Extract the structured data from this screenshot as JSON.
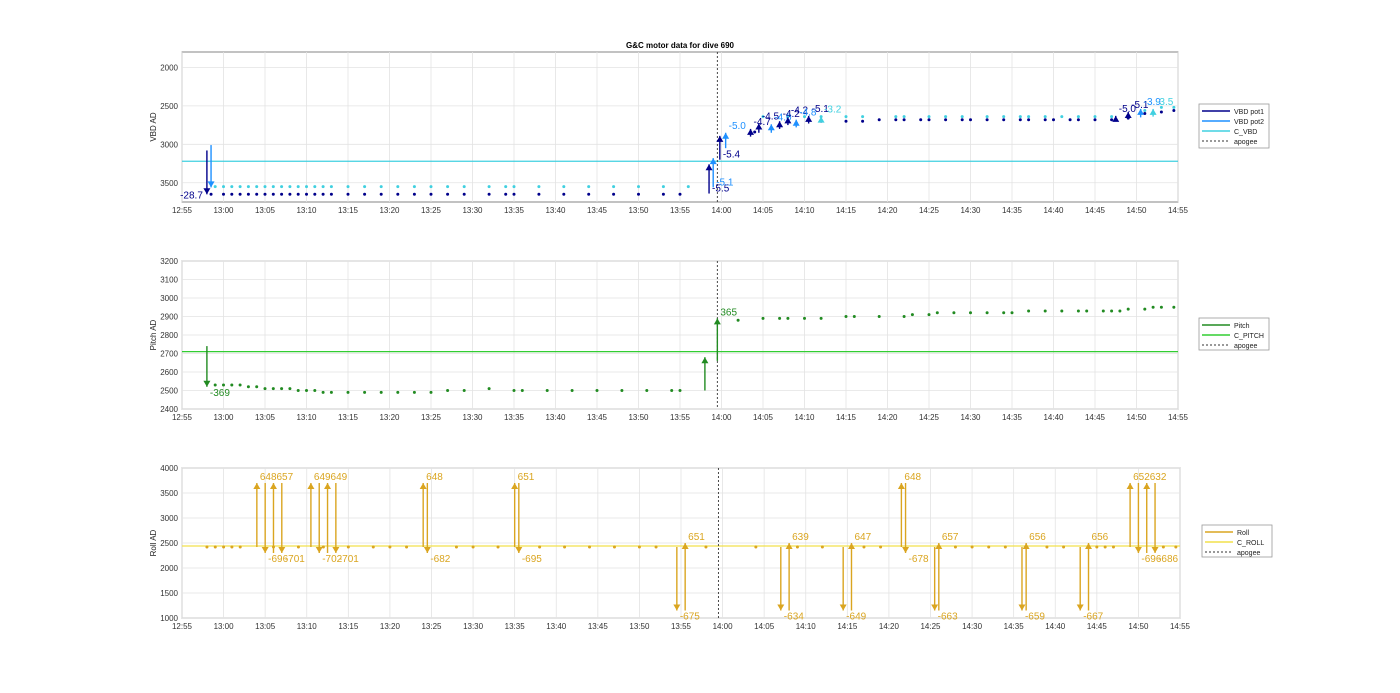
{
  "figure_title": "G&C motor data for dive 690",
  "colors": {
    "vbd_pot1": "#00008B",
    "vbd_pot2": "#1E90FF",
    "c_vbd": "#40D0E0",
    "pitch": "#228B22",
    "c_pitch": "#32CD32",
    "roll": "#DAA520",
    "c_roll": "#F2E14C",
    "apogee": "#333333"
  },
  "chart_data": [
    {
      "type": "scatter",
      "ylabel": "VBD AD",
      "ylim": [
        3750,
        1800
      ],
      "yticks": [
        2000,
        2500,
        3000,
        3500
      ],
      "reverse_y": true,
      "xlim": [
        "12:55",
        "14:55"
      ],
      "xticks": [
        "12:55",
        "13:00",
        "13:05",
        "13:10",
        "13:15",
        "13:20",
        "13:25",
        "13:30",
        "13:35",
        "13:40",
        "13:45",
        "13:50",
        "13:55",
        "14:00",
        "14:05",
        "14:10",
        "14:15",
        "14:20",
        "14:25",
        "14:30",
        "14:35",
        "14:40",
        "14:45",
        "14:50",
        "14:55"
      ],
      "grid": true,
      "legend_position": "right",
      "legend": [
        "VBD pot1",
        "VBD pot2",
        "C_VBD",
        "apogee"
      ],
      "apogee": "13:59.5",
      "reference_line": {
        "name": "C_VBD",
        "y": 3220
      },
      "series": [
        {
          "name": "VBD pot1",
          "x": [
            "12:58.5",
            "13:00",
            "13:01",
            "13:02",
            "13:03",
            "13:04",
            "13:05",
            "13:06",
            "13:07",
            "13:08",
            "13:09",
            "13:10",
            "13:11",
            "13:12",
            "13:13",
            "13:15",
            "13:17",
            "13:19",
            "13:21",
            "13:23",
            "13:25",
            "13:27",
            "13:29",
            "13:32",
            "13:34",
            "13:35",
            "13:38",
            "13:41",
            "13:44",
            "13:47",
            "13:50",
            "13:53",
            "13:55",
            "14:04",
            "14:07",
            "14:09",
            "14:12",
            "14:15",
            "14:17",
            "14:19",
            "14:21",
            "14:22",
            "14:24",
            "14:25",
            "14:27",
            "14:29",
            "14:30",
            "14:32",
            "14:34",
            "14:36",
            "14:37",
            "14:39",
            "14:40",
            "14:42",
            "14:43",
            "14:45",
            "14:47",
            "14:49",
            "14:51",
            "14:53",
            "14:54.5"
          ],
          "y": [
            3650,
            3650,
            3650,
            3650,
            3650,
            3650,
            3650,
            3650,
            3650,
            3650,
            3650,
            3650,
            3650,
            3650,
            3650,
            3650,
            3650,
            3650,
            3650,
            3650,
            3650,
            3650,
            3650,
            3650,
            3650,
            3650,
            3650,
            3650,
            3650,
            3650,
            3650,
            3650,
            3650,
            2840,
            2760,
            2720,
            2700,
            2700,
            2700,
            2680,
            2680,
            2680,
            2680,
            2680,
            2680,
            2680,
            2680,
            2680,
            2680,
            2680,
            2680,
            2680,
            2680,
            2680,
            2680,
            2680,
            2680,
            2660,
            2600,
            2580,
            2560
          ]
        },
        {
          "name": "C_VBD",
          "x": [
            "12:59",
            "13:00",
            "13:01",
            "13:02",
            "13:03",
            "13:04",
            "13:05",
            "13:06",
            "13:07",
            "13:08",
            "13:09",
            "13:10",
            "13:11",
            "13:12",
            "13:13",
            "13:15",
            "13:17",
            "13:19",
            "13:21",
            "13:23",
            "13:25",
            "13:27",
            "13:29",
            "13:32",
            "13:34",
            "13:35",
            "13:38",
            "13:41",
            "13:44",
            "13:47",
            "13:50",
            "13:53",
            "13:56",
            "14:05",
            "14:08",
            "14:10",
            "14:12",
            "14:15",
            "14:17",
            "14:21",
            "14:22",
            "14:25",
            "14:27",
            "14:29",
            "14:32",
            "14:34",
            "14:36",
            "14:37",
            "14:39",
            "14:41",
            "14:43",
            "14:45",
            "14:47",
            "14:49",
            "14:51",
            "14:53",
            "14:54.5"
          ],
          "y": [
            3550,
            3550,
            3550,
            3550,
            3550,
            3550,
            3550,
            3550,
            3550,
            3550,
            3550,
            3550,
            3550,
            3550,
            3550,
            3550,
            3550,
            3550,
            3550,
            3550,
            3550,
            3550,
            3550,
            3550,
            3550,
            3550,
            3550,
            3550,
            3550,
            3550,
            3550,
            3550,
            3550,
            2640,
            2640,
            2640,
            2640,
            2640,
            2640,
            2640,
            2640,
            2640,
            2640,
            2640,
            2640,
            2640,
            2640,
            2640,
            2640,
            2640,
            2640,
            2640,
            2640,
            2640,
            2560,
            2520,
            2520
          ]
        }
      ],
      "moves": [
        {
          "x": "12:58",
          "from": 3080,
          "to": 3650,
          "series": "VBD pot1",
          "label": "-28.7"
        },
        {
          "x": "12:58.5",
          "from": 3010,
          "to": 3560,
          "series": "VBD pot2",
          "label": ""
        },
        {
          "x": "13:58.5",
          "from": 3640,
          "to": 3260,
          "series": "VBD pot1",
          "label": "-5.5"
        },
        {
          "x": "13:59",
          "from": 3560,
          "to": 3180,
          "series": "VBD pot2",
          "label": "-5.1"
        },
        {
          "x": "13:59.8",
          "from": 3200,
          "to": 2890,
          "series": "VBD pot1",
          "label": "-5.4"
        },
        {
          "x": "14:00.5",
          "from": 3050,
          "to": 2850,
          "series": "VBD pot2",
          "label": "-5.0"
        },
        {
          "x": "14:03.5",
          "from": 2900,
          "to": 2800,
          "series": "VBD pot1",
          "label": "-4.7"
        },
        {
          "x": "14:04.5",
          "from": 2850,
          "to": 2730,
          "series": "VBD pot1",
          "label": "-4.5"
        },
        {
          "x": "14:06",
          "from": 2850,
          "to": 2740,
          "series": "VBD pot2",
          "label": "-4.0"
        },
        {
          "x": "14:07",
          "from": 2800,
          "to": 2700,
          "series": "VBD pot1",
          "label": "-4.2"
        },
        {
          "x": "14:08",
          "from": 2750,
          "to": 2650,
          "series": "VBD pot1",
          "label": "-4.2"
        },
        {
          "x": "14:09",
          "from": 2780,
          "to": 2680,
          "series": "VBD pot2",
          "label": "-4.8"
        },
        {
          "x": "14:10.5",
          "from": 2730,
          "to": 2630,
          "series": "VBD pot1",
          "label": "-5.1"
        },
        {
          "x": "14:12",
          "from": 2700,
          "to": 2640,
          "series": "C_VBD",
          "label": "-3.2"
        },
        {
          "x": "14:47.5",
          "from": 2700,
          "to": 2630,
          "series": "VBD pot1",
          "label": "-5.0"
        },
        {
          "x": "14:49",
          "from": 2660,
          "to": 2580,
          "series": "VBD pot1",
          "label": "-5.1"
        },
        {
          "x": "14:50.5",
          "from": 2650,
          "to": 2540,
          "series": "VBD pot2",
          "label": "-3.9"
        },
        {
          "x": "14:52",
          "from": 2640,
          "to": 2540,
          "series": "C_VBD",
          "label": "-3.5"
        }
      ]
    },
    {
      "type": "scatter",
      "ylabel": "Pitch AD",
      "ylim": [
        2400,
        3200
      ],
      "yticks": [
        2400,
        2500,
        2600,
        2700,
        2800,
        2900,
        3000,
        3100,
        3200
      ],
      "xlim": [
        "12:55",
        "14:55"
      ],
      "xticks": [
        "12:55",
        "13:00",
        "13:05",
        "13:10",
        "13:15",
        "13:20",
        "13:25",
        "13:30",
        "13:35",
        "13:40",
        "13:45",
        "13:50",
        "13:55",
        "14:00",
        "14:05",
        "14:10",
        "14:15",
        "14:20",
        "14:25",
        "14:30",
        "14:35",
        "14:40",
        "14:45",
        "14:50",
        "14:55"
      ],
      "grid": true,
      "legend_position": "right",
      "legend": [
        "Pitch",
        "C_PITCH",
        "apogee"
      ],
      "apogee": "13:59.5",
      "reference_line": {
        "name": "C_PITCH",
        "y": 2710
      },
      "series": [
        {
          "name": "Pitch",
          "x": [
            "12:59",
            "13:00",
            "13:01",
            "13:02",
            "13:03",
            "13:04",
            "13:05",
            "13:06",
            "13:07",
            "13:08",
            "13:09",
            "13:10",
            "13:11",
            "13:12",
            "13:13",
            "13:15",
            "13:17",
            "13:19",
            "13:21",
            "13:23",
            "13:25",
            "13:27",
            "13:29",
            "13:32",
            "13:35",
            "13:36",
            "13:39",
            "13:42",
            "13:45",
            "13:48",
            "13:51",
            "13:54",
            "13:55",
            "14:02",
            "14:05",
            "14:07",
            "14:08",
            "14:10",
            "14:12",
            "14:15",
            "14:16",
            "14:19",
            "14:22",
            "14:23",
            "14:25",
            "14:26",
            "14:28",
            "14:30",
            "14:32",
            "14:34",
            "14:35",
            "14:37",
            "14:39",
            "14:41",
            "14:43",
            "14:44",
            "14:46",
            "14:47",
            "14:48",
            "14:49",
            "14:51",
            "14:52",
            "14:53",
            "14:54.5"
          ],
          "y": [
            2530,
            2530,
            2530,
            2530,
            2520,
            2520,
            2510,
            2510,
            2510,
            2510,
            2500,
            2500,
            2500,
            2490,
            2490,
            2490,
            2490,
            2490,
            2490,
            2490,
            2490,
            2500,
            2500,
            2510,
            2500,
            2500,
            2500,
            2500,
            2500,
            2500,
            2500,
            2500,
            2500,
            2880,
            2890,
            2890,
            2890,
            2890,
            2890,
            2900,
            2900,
            2900,
            2900,
            2910,
            2910,
            2920,
            2920,
            2920,
            2920,
            2920,
            2920,
            2930,
            2930,
            2930,
            2930,
            2930,
            2930,
            2930,
            2930,
            2940,
            2940,
            2950,
            2950,
            2950
          ]
        }
      ],
      "moves": [
        {
          "x": "12:58",
          "from": 2740,
          "to": 2520,
          "label": "-369"
        },
        {
          "x": "13:58",
          "from": 2500,
          "to": 2680,
          "label": ""
        },
        {
          "x": "13:59.5",
          "from": 2660,
          "to": 2890,
          "label": "365"
        }
      ]
    },
    {
      "type": "scatter",
      "ylabel": "Roll AD",
      "ylim": [
        1000,
        4000
      ],
      "yticks": [
        1000,
        1500,
        2000,
        2500,
        3000,
        3500,
        4000
      ],
      "xlim": [
        "12:55",
        "14:55"
      ],
      "xticks": [
        "12:55",
        "13:00",
        "13:05",
        "13:10",
        "13:15",
        "13:20",
        "13:25",
        "13:30",
        "13:35",
        "13:40",
        "13:45",
        "13:50",
        "13:55",
        "14:00",
        "14:05",
        "14:10",
        "14:15",
        "14:20",
        "14:25",
        "14:30",
        "14:35",
        "14:40",
        "14:45",
        "14:50",
        "14:55"
      ],
      "grid": true,
      "legend_position": "right",
      "legend": [
        "Roll",
        "C_ROLL",
        "apogee"
      ],
      "apogee": "13:59.5",
      "reference_line": {
        "name": "C_ROLL",
        "y": 2440
      },
      "series": [
        {
          "name": "Roll",
          "x": [
            "12:58",
            "12:59",
            "13:00",
            "13:01",
            "13:02",
            "13:06",
            "13:09",
            "13:12",
            "13:15",
            "13:18",
            "13:20",
            "13:22",
            "13:28",
            "13:30",
            "13:33",
            "13:38",
            "13:41",
            "13:44",
            "13:47",
            "13:50",
            "13:52",
            "13:58",
            "14:04",
            "14:09",
            "14:12",
            "14:17",
            "14:19",
            "14:28",
            "14:30",
            "14:32",
            "14:34",
            "14:39",
            "14:41",
            "14:45",
            "14:46",
            "14:47",
            "14:53",
            "14:54.5"
          ],
          "y": [
            2420,
            2420,
            2420,
            2420,
            2420,
            2420,
            2420,
            2420,
            2420,
            2420,
            2420,
            2420,
            2420,
            2420,
            2420,
            2420,
            2420,
            2420,
            2420,
            2420,
            2420,
            2420,
            2420,
            2420,
            2420,
            2420,
            2420,
            2420,
            2420,
            2420,
            2420,
            2420,
            2420,
            2420,
            2420,
            2420,
            2420,
            2420
          ]
        }
      ],
      "moves": [
        {
          "x": "13:04",
          "from": 2420,
          "to": 3700,
          "label": "648"
        },
        {
          "x": "13:05",
          "from": 3700,
          "to": 2300,
          "label": "-696"
        },
        {
          "x": "13:06",
          "from": 2300,
          "to": 3700,
          "label": "657"
        },
        {
          "x": "13:07",
          "from": 3700,
          "to": 2300,
          "label": "-701"
        },
        {
          "x": "13:10.5",
          "from": 2420,
          "to": 3700,
          "label": "649"
        },
        {
          "x": "13:11.5",
          "from": 3700,
          "to": 2300,
          "label": "-702"
        },
        {
          "x": "13:12.5",
          "from": 2300,
          "to": 3700,
          "label": "649"
        },
        {
          "x": "13:13.5",
          "from": 3700,
          "to": 2300,
          "label": "-701"
        },
        {
          "x": "13:24",
          "from": 2420,
          "to": 3700,
          "label": "648"
        },
        {
          "x": "13:24.5",
          "from": 3700,
          "to": 2300,
          "label": "-682"
        },
        {
          "x": "13:35",
          "from": 2420,
          "to": 3700,
          "label": "651"
        },
        {
          "x": "13:35.5",
          "from": 3700,
          "to": 2300,
          "label": "-695"
        },
        {
          "x": "13:54.5",
          "from": 2420,
          "to": 1150,
          "label": "-675"
        },
        {
          "x": "13:55.5",
          "from": 1150,
          "to": 2500,
          "label": "651"
        },
        {
          "x": "14:07",
          "from": 2420,
          "to": 1150,
          "label": "-634"
        },
        {
          "x": "14:08",
          "from": 1150,
          "to": 2500,
          "label": "639"
        },
        {
          "x": "14:14.5",
          "from": 2420,
          "to": 1150,
          "label": "-649"
        },
        {
          "x": "14:15.5",
          "from": 1150,
          "to": 2500,
          "label": "647"
        },
        {
          "x": "14:21.5",
          "from": 2420,
          "to": 3700,
          "label": "648"
        },
        {
          "x": "14:22",
          "from": 3700,
          "to": 2300,
          "label": "-678"
        },
        {
          "x": "14:25.5",
          "from": 2420,
          "to": 1150,
          "label": "-663"
        },
        {
          "x": "14:26",
          "from": 1150,
          "to": 2500,
          "label": "657"
        },
        {
          "x": "14:36",
          "from": 2420,
          "to": 1150,
          "label": "-659"
        },
        {
          "x": "14:36.5",
          "from": 1150,
          "to": 2500,
          "label": "656"
        },
        {
          "x": "14:43",
          "from": 2420,
          "to": 1150,
          "label": "-667"
        },
        {
          "x": "14:44",
          "from": 1150,
          "to": 2500,
          "label": "656"
        },
        {
          "x": "14:49",
          "from": 2420,
          "to": 3700,
          "label": "652"
        },
        {
          "x": "14:50",
          "from": 3700,
          "to": 2300,
          "label": "-696"
        },
        {
          "x": "14:51",
          "from": 2300,
          "to": 3700,
          "label": "632"
        },
        {
          "x": "14:52",
          "from": 3700,
          "to": 2300,
          "label": "-686"
        }
      ]
    }
  ]
}
